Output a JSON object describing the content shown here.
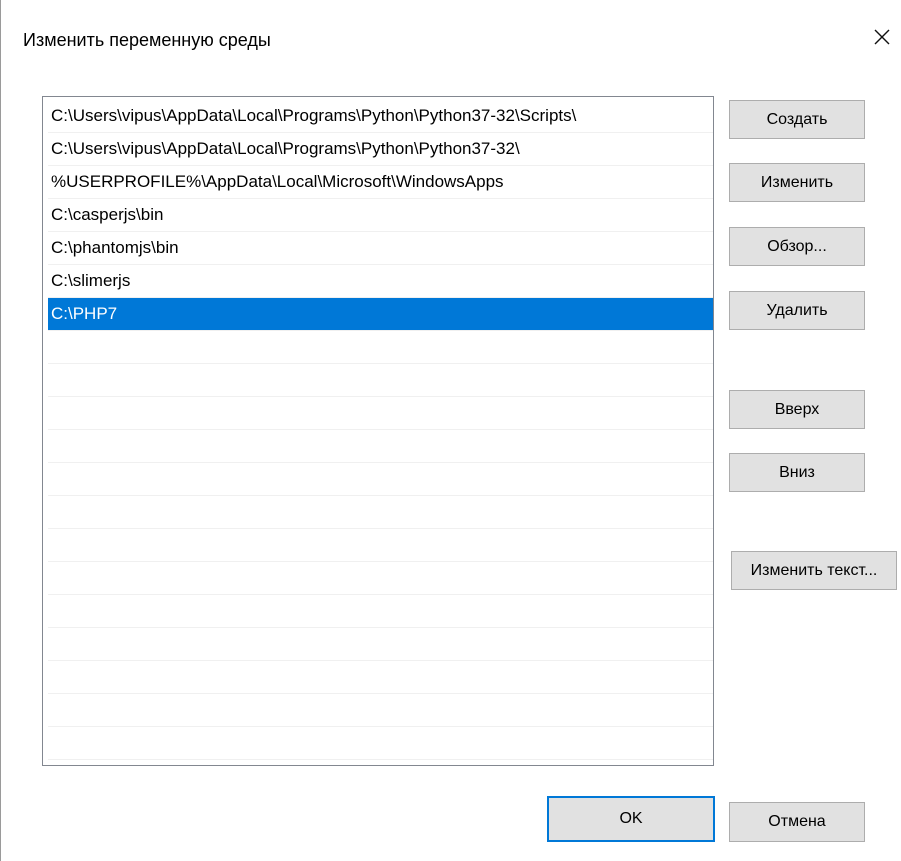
{
  "window": {
    "title": "Изменить переменную среды"
  },
  "list": {
    "items": [
      "C:\\Users\\vipus\\AppData\\Local\\Programs\\Python\\Python37-32\\Scripts\\",
      "C:\\Users\\vipus\\AppData\\Local\\Programs\\Python\\Python37-32\\",
      "%USERPROFILE%\\AppData\\Local\\Microsoft\\WindowsApps",
      "C:\\casperjs\\bin",
      "C:\\phantomjs\\bin",
      "C:\\slimerjs",
      "C:\\PHP7"
    ],
    "selected_index": 6
  },
  "buttons": {
    "create": "Создать",
    "edit": "Изменить",
    "browse": "Обзор...",
    "delete": "Удалить",
    "up": "Вверх",
    "down": "Вниз",
    "edit_text": "Изменить текст...",
    "ok": "OK",
    "cancel": "Отмена"
  },
  "colors": {
    "selection": "#0078d7",
    "button_face": "#e1e1e1",
    "button_border": "#adadad"
  },
  "icons": {
    "close": "close-icon"
  }
}
